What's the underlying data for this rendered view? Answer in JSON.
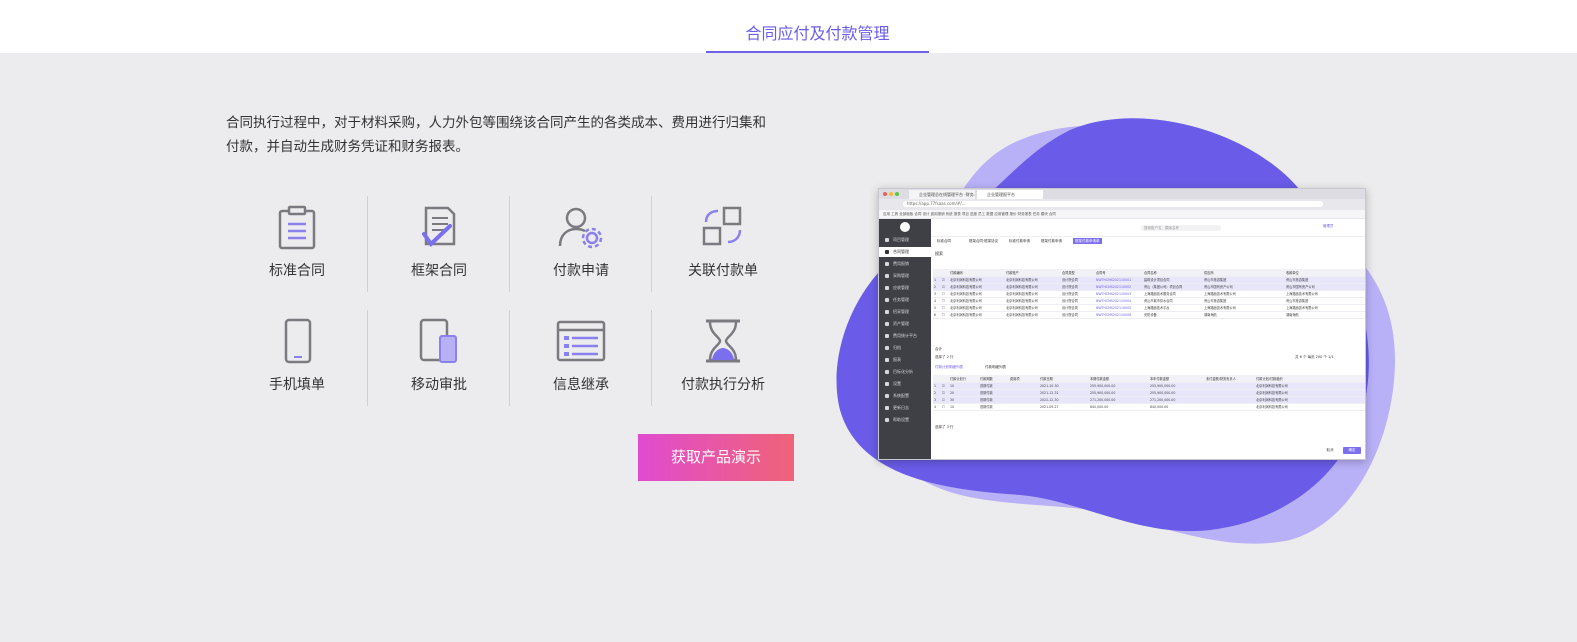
{
  "header": {
    "tab_title": "合同应付及付款管理"
  },
  "intro": {
    "line1": "合同执行过程中，对于材料采购，人力外包等围绕该合同产生的各类成本、费用进行归集和",
    "line2": "付款，并自动生成财务凭证和财务报表。"
  },
  "features": [
    {
      "label": "标准合同",
      "icon": "clipboard-icon"
    },
    {
      "label": "框架合同",
      "icon": "document-check-icon"
    },
    {
      "label": "付款申请",
      "icon": "user-gear-icon"
    },
    {
      "label": "关联付款单",
      "icon": "linked-squares-icon"
    },
    {
      "label": "手机填单",
      "icon": "mobile-phone-icon"
    },
    {
      "label": "移动审批",
      "icon": "tablet-phone-icon"
    },
    {
      "label": "信息继承",
      "icon": "browser-window-icon"
    },
    {
      "label": "付款执行分析",
      "icon": "hourglass-icon"
    }
  ],
  "cta": {
    "label": "获取产品演示"
  },
  "colors": {
    "accent": "#6e62e6",
    "blob_dark": "#6a5ce8",
    "blob_light": "#b9b1f7",
    "cta_start": "#e04bd0",
    "cta_end": "#f06377"
  },
  "mock_app": {
    "browser_tabs": [
      "企业管理总在线管理平台 -财务...",
      "企业管理报平台"
    ],
    "url": "https://app.77fsaas.com/#/...",
    "bookmarks": "应用  工具  全部面板  合同  设计  费用报销  系统  报表  项目  进度  员工  数据  应用管理  报价  财务报表  任务  模块  合同",
    "header_center": "搜索账户名、模版名称",
    "header_right": "管理员",
    "sidebar": [
      "项目管理",
      "合同管理",
      "费用报销",
      "采购管理",
      "应收管理",
      "任务管理",
      "招采管理",
      "资产管理",
      "费用统计平台",
      "归档",
      "报表",
      "目标化分析",
      "设置",
      "系统配置",
      "更新日志",
      "帮助设置"
    ],
    "subtabs": [
      "标准合同",
      "框架合同·框架协议",
      "标准付款申请",
      "框架付款申请",
      "框架付款申请单"
    ],
    "section_title": "搜索",
    "table1": {
      "headers": [
        "",
        "",
        "付款编码",
        "付款账户",
        "合同类型",
        "合同号",
        "合同名称",
        "供应商",
        "收款单位"
      ],
      "rows": [
        [
          "1",
          "",
          "北京利润科技有限公司",
          "北京利润科技有限公司",
          "设计院合同",
          "NWTHCMS202110001",
          "建筑设计项目合同",
          "黄山市旅游集团",
          "黄山市旅游集团"
        ],
        [
          "2",
          "",
          "北京利润科技有限公司",
          "北京利润科技有限公司",
          "设计院合同",
          "NWTHCMS202110002",
          "黄山（集团公司）项目合同",
          "黄山市国有资产公司",
          "黄山市国有资产公司"
        ],
        [
          "3",
          "",
          "北京利润科技有限公司",
          "北京利润科技有限公司",
          "设计院合同",
          "NWTHCMS202110003",
          "上海路面技术服务合同",
          "上海路面技术有限公司",
          "上海路面技术有限公司"
        ],
        [
          "4",
          "",
          "北京利润科技有限公司",
          "北京利润科技有限公司",
          "设计院合同",
          "NWTHCMS202110004",
          "黄山市城市供水合同",
          "黄山市旅游集团",
          "黄山市旅游集团"
        ],
        [
          "5",
          "",
          "北京利润科技有限公司",
          "北京利润科技有限公司",
          "设计院合同",
          "NWTHCMS202110005",
          "上海路面技术平台",
          "上海路面技术有限公司",
          "上海路面技术有限公司"
        ],
        [
          "6",
          "",
          "北京利润科技有限公司",
          "北京利润科技有限公司",
          "设计院合同",
          "NWTHCMS202110006",
          "安防设备",
          "湖南海航",
          "湖南海航"
        ]
      ]
    },
    "summary1": "合计",
    "selected1": "选择了 2 行",
    "lower_tabs": [
      "付款计划明细列表",
      "付款明细列表"
    ],
    "table2": {
      "headers": [
        "",
        "",
        "付款计划行",
        "付款期数",
        "费用项",
        "付款日期",
        "本期付款金额",
        "本年付款金额",
        "未付金额/财务负责人",
        "付款计划/付款组织"
      ],
      "rows": [
        [
          "1",
          "",
          "10",
          "首期付款",
          "",
          "2021-10-30",
          "255,900,000.00",
          "255,900,000.00",
          "",
          "北京利润科技有限公司"
        ],
        [
          "2",
          "",
          "20",
          "首期付款",
          "",
          "2021-12-31",
          "255,900,000.00",
          "255,900,000.00",
          "",
          "北京利润科技有限公司"
        ],
        [
          "3",
          "",
          "30",
          "首期付款",
          "",
          "2022-12-30",
          "271,200,000.00",
          "271,200,000.00",
          "",
          "北京利润科技有限公司"
        ],
        [
          "4",
          "",
          "10",
          "首期付款",
          "",
          "2021-09-27",
          "840,000.00",
          "840,000.00",
          "",
          "北京利润科技有限公司"
        ]
      ]
    },
    "selected2": "选择了 3 行",
    "pager": "共 6 个  每页 200 个  1/1",
    "cancel": "取消",
    "confirm": "确定"
  }
}
